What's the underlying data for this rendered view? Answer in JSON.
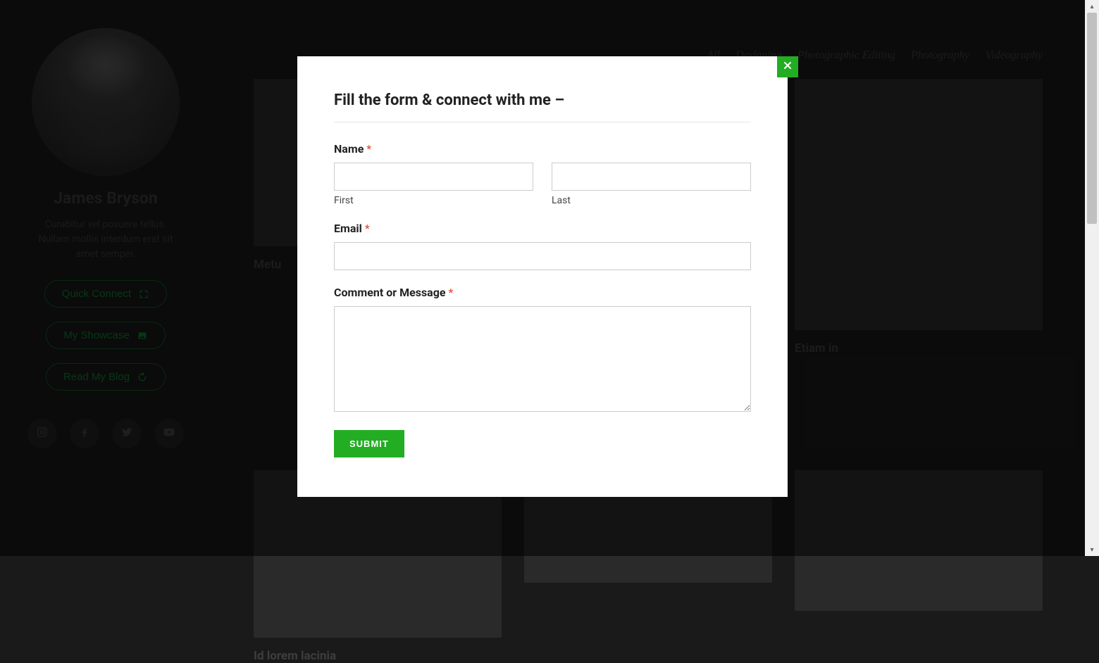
{
  "sidebar": {
    "name": "James Bryson",
    "tagline": "Curabitur vel posuere tellus. Nullam mollis interdum erat sit amet semper.",
    "buttons": {
      "quick_connect": "Quick Connect",
      "my_showcase": "My Showcase",
      "read_blog": "Read My Blog"
    },
    "social": [
      "instagram",
      "facebook",
      "twitter",
      "youtube"
    ]
  },
  "filters": [
    "All",
    "Designing",
    "Photographic Editing",
    "Photography",
    "Videography"
  ],
  "cards": {
    "c0": {
      "title": "Metu"
    },
    "c1": {
      "title": ""
    },
    "c2": {
      "title": "Etiam in"
    },
    "c3": {
      "title": "Id lorem lacinia"
    },
    "c4": {
      "title": ""
    },
    "c5": {
      "title": ""
    }
  },
  "modal": {
    "title": "Fill the form & connect with me –",
    "name_label": "Name ",
    "first_label": "First",
    "last_label": "Last",
    "email_label": "Email ",
    "comment_label": "Comment or Message ",
    "submit_label": "SUBMIT",
    "required_marker": "*"
  }
}
